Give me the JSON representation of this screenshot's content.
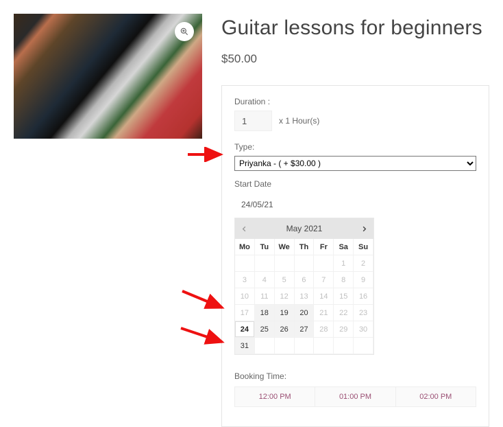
{
  "product": {
    "title": "Guitar lessons for beginners",
    "price": "$50.00"
  },
  "booking": {
    "duration_label": "Duration :",
    "duration_value": "1",
    "duration_suffix": "x 1 Hour(s)",
    "type_label": "Type:",
    "type_selected": "Priyanka - ( + $30.00 )",
    "start_date_label": "Start Date",
    "start_date_value": "24/05/21",
    "booking_time_label": "Booking Time:",
    "time_slots": [
      "12:00 PM",
      "01:00 PM",
      "02:00 PM"
    ]
  },
  "calendar": {
    "month_label": "May 2021",
    "dow": [
      "Mo",
      "Tu",
      "We",
      "Th",
      "Fr",
      "Sa",
      "Su"
    ],
    "weeks": [
      [
        {
          "d": "",
          "e": false
        },
        {
          "d": "",
          "e": false
        },
        {
          "d": "",
          "e": false
        },
        {
          "d": "",
          "e": false
        },
        {
          "d": "",
          "e": false
        },
        {
          "d": "1",
          "e": false
        },
        {
          "d": "2",
          "e": false
        }
      ],
      [
        {
          "d": "3",
          "e": false
        },
        {
          "d": "4",
          "e": false
        },
        {
          "d": "5",
          "e": false
        },
        {
          "d": "6",
          "e": false
        },
        {
          "d": "7",
          "e": false
        },
        {
          "d": "8",
          "e": false
        },
        {
          "d": "9",
          "e": false
        }
      ],
      [
        {
          "d": "10",
          "e": false
        },
        {
          "d": "11",
          "e": false
        },
        {
          "d": "12",
          "e": false
        },
        {
          "d": "13",
          "e": false
        },
        {
          "d": "14",
          "e": false
        },
        {
          "d": "15",
          "e": false
        },
        {
          "d": "16",
          "e": false
        }
      ],
      [
        {
          "d": "17",
          "e": false
        },
        {
          "d": "18",
          "e": true
        },
        {
          "d": "19",
          "e": true
        },
        {
          "d": "20",
          "e": true
        },
        {
          "d": "21",
          "e": false
        },
        {
          "d": "22",
          "e": false
        },
        {
          "d": "23",
          "e": false
        }
      ],
      [
        {
          "d": "24",
          "e": true,
          "sel": true
        },
        {
          "d": "25",
          "e": true
        },
        {
          "d": "26",
          "e": true
        },
        {
          "d": "27",
          "e": true
        },
        {
          "d": "28",
          "e": false
        },
        {
          "d": "29",
          "e": false
        },
        {
          "d": "30",
          "e": false
        }
      ],
      [
        {
          "d": "31",
          "e": true
        },
        {
          "d": "",
          "e": false
        },
        {
          "d": "",
          "e": false
        },
        {
          "d": "",
          "e": false
        },
        {
          "d": "",
          "e": false
        },
        {
          "d": "",
          "e": false
        },
        {
          "d": "",
          "e": false
        }
      ]
    ]
  },
  "icons": {
    "zoom": "zoom-icon",
    "prev": "chevron-left-icon",
    "next": "chevron-right-icon"
  }
}
